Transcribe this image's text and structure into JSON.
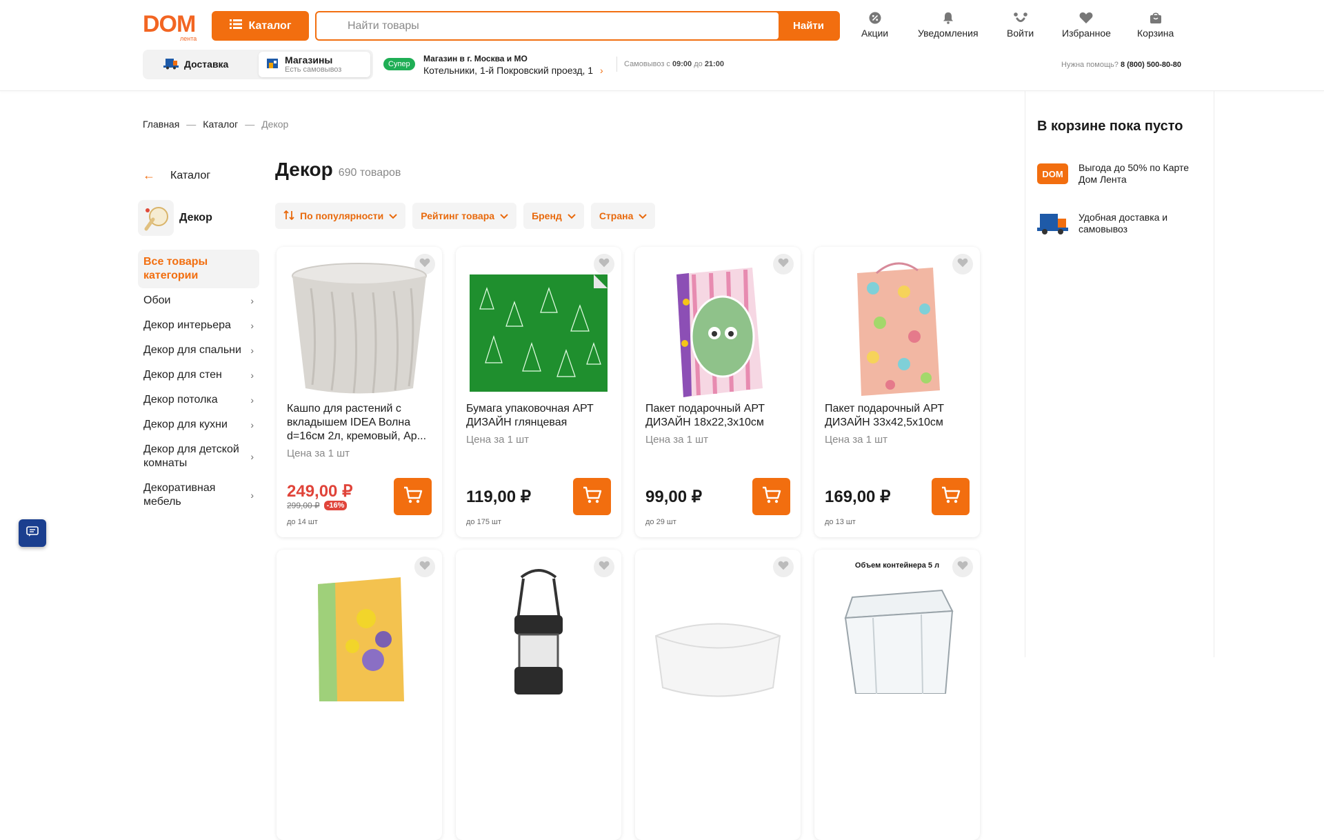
{
  "brand": {
    "logo": "DOM",
    "logo_sub": "лента",
    "accent": "#f26e0f"
  },
  "header": {
    "catalog_label": "Каталог",
    "search_placeholder": "Найти товары",
    "search_button": "Найти",
    "nav": [
      {
        "label": "Акции",
        "icon": "percent-icon"
      },
      {
        "label": "Уведомления",
        "icon": "bell-icon"
      },
      {
        "label": "Войти",
        "icon": "smile-icon"
      },
      {
        "label": "Избранное",
        "icon": "heart-icon"
      },
      {
        "label": "Корзина",
        "icon": "bag-icon"
      }
    ],
    "delivery_label": "Доставка",
    "stores_label": "Магазины",
    "stores_sub": "Есть самовывоз",
    "store_badge": "Супер",
    "store_city": "Магазин в г. Москва и МО",
    "store_address": "Котельники, 1-й Покровский проезд, 1",
    "pickup_prefix": "Самовывоз с",
    "pickup_from": "09:00",
    "pickup_mid": "до",
    "pickup_to": "21:00",
    "help_label": "Нужна помощь?",
    "help_phone": "8 (800) 500-80-80"
  },
  "breadcrumb": [
    "Главная",
    "Каталог",
    "Декор"
  ],
  "sidebar": {
    "back_label": "Каталог",
    "category": "Декор",
    "items": [
      {
        "label": "Все товары категории",
        "active": true
      },
      {
        "label": "Обои"
      },
      {
        "label": "Декор интерьера"
      },
      {
        "label": "Декор для спальни"
      },
      {
        "label": "Декор для стен"
      },
      {
        "label": "Декор потолка"
      },
      {
        "label": "Декор для кухни"
      },
      {
        "label": "Декор для детской комнаты"
      },
      {
        "label": "Декоративная мебель"
      }
    ]
  },
  "main": {
    "title": "Декор",
    "count": "690 товаров",
    "filters": [
      "По популярности",
      "Рейтинг товара",
      "Бренд",
      "Страна"
    ]
  },
  "products": [
    {
      "name": "Кашпо для растений с вкладышем IDEA Волна d=16см 2л, кремовый, Ар...",
      "unit": "Цена за 1 шт",
      "price": "249,00 ₽",
      "old_price": "299,00 ₽",
      "discount": "-16%",
      "stock": "до 14 шт"
    },
    {
      "name": "Бумага упаковочная АРТ ДИЗАЙН глянцевая",
      "unit": "Цена за 1 шт",
      "price": "119,00 ₽",
      "stock": "до 175 шт"
    },
    {
      "name": "Пакет подарочный АРТ ДИЗАЙН 18x22,3x10см",
      "unit": "Цена за 1 шт",
      "price": "99,00 ₽",
      "stock": "до 29 шт"
    },
    {
      "name": "Пакет подарочный АРТ ДИЗАЙН 33x42,5x10см",
      "unit": "Цена за 1 шт",
      "price": "169,00 ₽",
      "stock": "до 13 шт"
    }
  ],
  "products_row2_caption": "Объем контейнера 5 л",
  "cart": {
    "empty_title": "В корзине пока пусто",
    "perks": [
      {
        "text": "Выгода до 50% по Карте Дом Лента",
        "icon": "dom-card-icon"
      },
      {
        "text": "Удобная доставка и самовывоз",
        "icon": "truck-icon"
      }
    ]
  }
}
